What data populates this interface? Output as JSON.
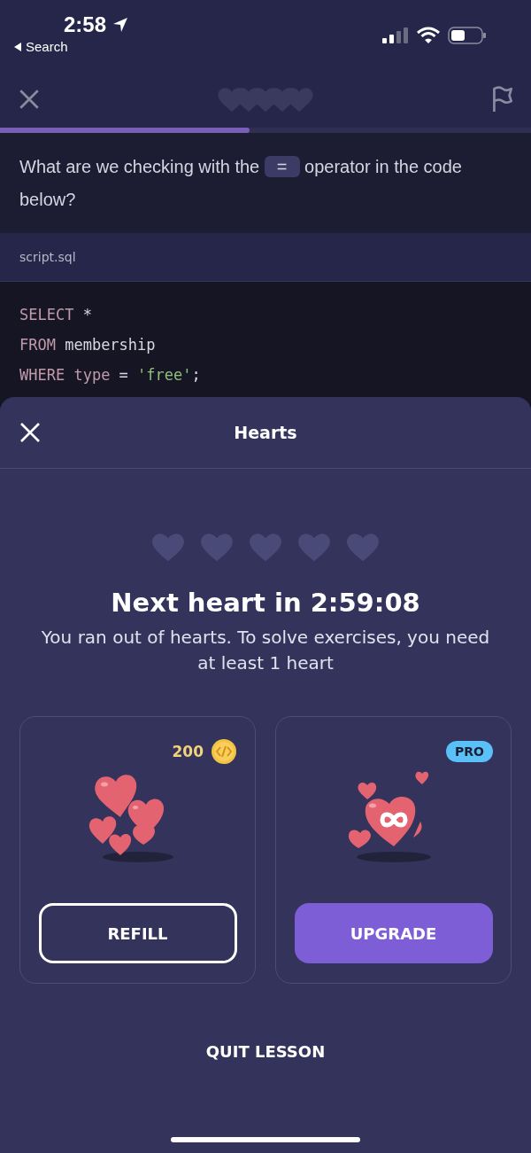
{
  "status_bar": {
    "time": "2:58",
    "back_label": "Search"
  },
  "top_bar": {
    "hearts": [
      {
        "filled": false
      },
      {
        "filled": false
      },
      {
        "filled": false
      },
      {
        "filled": false
      },
      {
        "filled": false
      }
    ],
    "progress": {
      "level": 0.47
    }
  },
  "question": [
    {
      "kind": "text",
      "text": "What are we checking with the"
    },
    {
      "kind": "code",
      "text": "="
    },
    {
      "kind": "text",
      "text": "operator in the code below?"
    }
  ],
  "file_tab": "script.sql",
  "code_lines": [
    [
      {
        "kind": "keyword",
        "text": "SELECT"
      },
      {
        "kind": "plain",
        "text": " *"
      }
    ],
    [
      {
        "kind": "keyword",
        "text": "FROM"
      },
      {
        "kind": "plain",
        "text": " membership"
      }
    ],
    [
      {
        "kind": "keyword",
        "text": "WHERE"
      },
      {
        "kind": "keyword",
        "text": " type"
      },
      {
        "kind": "plain",
        "text": " = "
      },
      {
        "kind": "string",
        "text": "'free'"
      },
      {
        "kind": "plain",
        "text": ";"
      }
    ]
  ],
  "sheet": {
    "title": "Hearts",
    "hearts": [
      {
        "filled": false
      },
      {
        "filled": false
      },
      {
        "filled": false
      },
      {
        "filled": false
      },
      {
        "filled": false
      }
    ],
    "heading": "Next heart in 2:59:08",
    "message": "You ran out of hearts. To solve exercises, you need at least 1 heart",
    "options": [
      {
        "kind": "refill",
        "price": "200",
        "button": "REFILL"
      },
      {
        "kind": "upgrade",
        "badge": "PRO",
        "button": "UPGRADE"
      }
    ],
    "quit_label": "QUIT LESSON"
  }
}
